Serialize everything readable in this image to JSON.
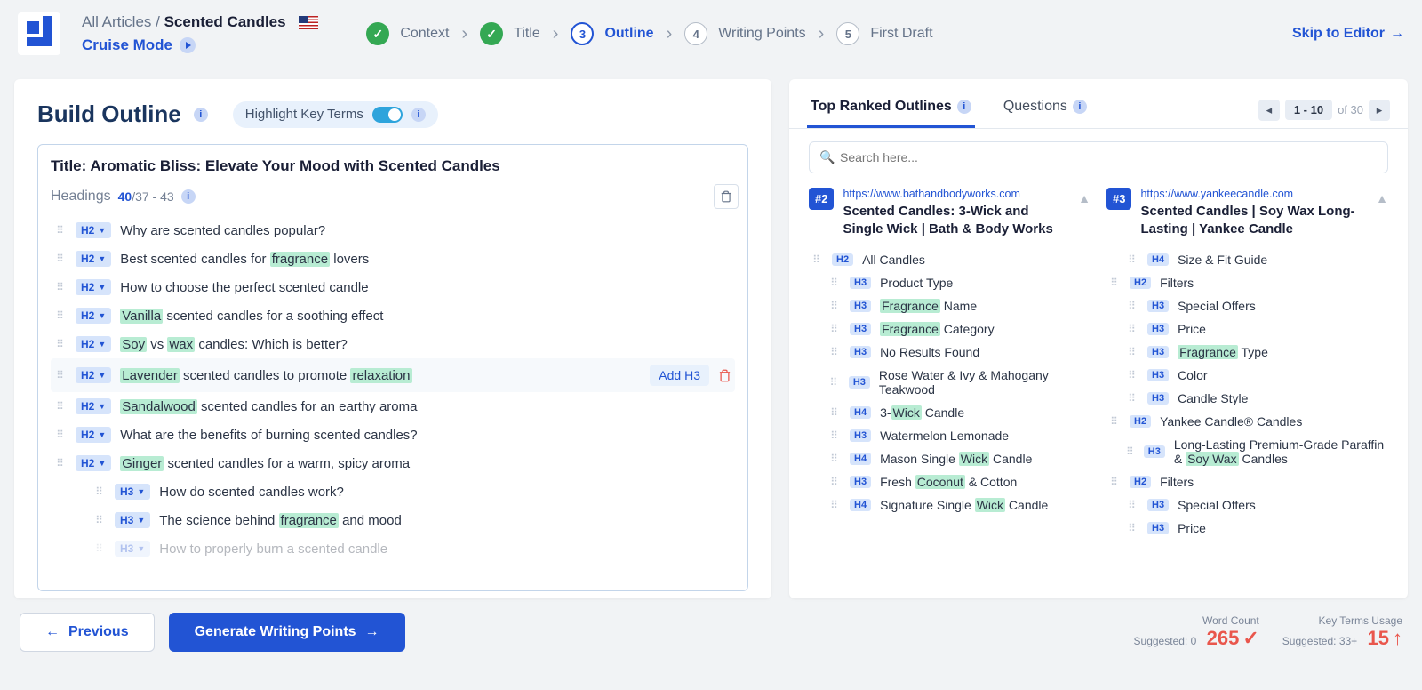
{
  "header": {
    "breadcrumb_root": "All Articles",
    "breadcrumb_current": "Scented Candles",
    "cruise_label": "Cruise Mode",
    "skip_label": "Skip to Editor"
  },
  "steps": [
    {
      "num": "✓",
      "label": "Context",
      "state": "done"
    },
    {
      "num": "✓",
      "label": "Title",
      "state": "done"
    },
    {
      "num": "3",
      "label": "Outline",
      "state": "active"
    },
    {
      "num": "4",
      "label": "Writing Points",
      "state": "pending"
    },
    {
      "num": "5",
      "label": "First Draft",
      "state": "pending"
    }
  ],
  "build": {
    "title": "Build Outline",
    "highlight_label": "Highlight Key Terms",
    "article_title_prefix": "Title: ",
    "article_title": "Aromatic Bliss: Elevate Your Mood with Scented Candles",
    "headings_label": "Headings",
    "headings_count": "40",
    "headings_range": "/37 - 43",
    "add_h3_label": "Add H3"
  },
  "outline": [
    {
      "tag": "H2",
      "parts": [
        "Why are scented candles popular?"
      ]
    },
    {
      "tag": "H2",
      "parts": [
        "Best scented candles for ",
        {
          "k": "fragrance"
        },
        " lovers"
      ]
    },
    {
      "tag": "H2",
      "parts": [
        "How to choose the perfect scented candle"
      ]
    },
    {
      "tag": "H2",
      "parts": [
        {
          "k": "Vanilla"
        },
        " scented candles for a soothing effect"
      ]
    },
    {
      "tag": "H2",
      "parts": [
        {
          "k": "Soy"
        },
        " vs ",
        {
          "k": "wax"
        },
        " candles: Which is better?"
      ]
    },
    {
      "tag": "H2",
      "parts": [
        {
          "k": "Lavender"
        },
        " scented candles to promote ",
        {
          "k": "relaxation"
        }
      ],
      "hovered": true
    },
    {
      "tag": "H2",
      "parts": [
        {
          "k": "Sandalwood"
        },
        " scented candles for an earthy aroma"
      ]
    },
    {
      "tag": "H2",
      "parts": [
        "What are the benefits of burning scented candles?"
      ]
    },
    {
      "tag": "H2",
      "parts": [
        {
          "k": "Ginger"
        },
        " scented candles for a warm, spicy aroma"
      ]
    },
    {
      "tag": "H3",
      "parts": [
        "How do scented candles work?"
      ],
      "indent": 1
    },
    {
      "tag": "H3",
      "parts": [
        "The science behind ",
        {
          "k": "fragrance"
        },
        " and mood"
      ],
      "indent": 1
    },
    {
      "tag": "H3",
      "parts": [
        "How to properly burn a scented candle"
      ],
      "indent": 1,
      "fade": true
    }
  ],
  "right": {
    "tab1": "Top Ranked Outlines",
    "tab2": "Questions",
    "range": "1 - 10",
    "total": "of 30",
    "search_placeholder": "Search here..."
  },
  "cards": [
    {
      "rank": "#2",
      "url": "https://www.bathandbodyworks.com",
      "title": "Scented Candles: 3-Wick and Single Wick | Bath & Body Works",
      "items": [
        {
          "tag": "H2",
          "parts": [
            "All Candles"
          ]
        },
        {
          "tag": "H3",
          "parts": [
            "Product Type"
          ],
          "indent": 1
        },
        {
          "tag": "H3",
          "parts": [
            {
              "k": "Fragrance"
            },
            " Name"
          ],
          "indent": 1
        },
        {
          "tag": "H3",
          "parts": [
            {
              "k": "Fragrance"
            },
            " Category"
          ],
          "indent": 1
        },
        {
          "tag": "H3",
          "parts": [
            "No Results Found"
          ],
          "indent": 1
        },
        {
          "tag": "H3",
          "parts": [
            "Rose Water & Ivy & Mahogany Teakwood"
          ],
          "indent": 1
        },
        {
          "tag": "H4",
          "parts": [
            "3-",
            {
              "k": "Wick"
            },
            " Candle"
          ],
          "indent": 1
        },
        {
          "tag": "H3",
          "parts": [
            "Watermelon Lemonade"
          ],
          "indent": 1
        },
        {
          "tag": "H4",
          "parts": [
            "Mason Single ",
            {
              "k": "Wick"
            },
            " Candle"
          ],
          "indent": 1
        },
        {
          "tag": "H3",
          "parts": [
            "Fresh ",
            {
              "k": "Coconut"
            },
            " & Cotton"
          ],
          "indent": 1
        },
        {
          "tag": "H4",
          "parts": [
            "Signature Single ",
            {
              "k": "Wick"
            },
            " Candle"
          ],
          "indent": 1
        }
      ]
    },
    {
      "rank": "#3",
      "url": "https://www.yankeecandle.com",
      "title": "Scented Candles | Soy Wax Long-Lasting | Yankee Candle",
      "items": [
        {
          "tag": "H4",
          "parts": [
            "Size & Fit Guide"
          ],
          "indent": 1
        },
        {
          "tag": "H2",
          "parts": [
            "Filters"
          ]
        },
        {
          "tag": "H3",
          "parts": [
            "Special Offers"
          ],
          "indent": 1
        },
        {
          "tag": "H3",
          "parts": [
            "Price"
          ],
          "indent": 1
        },
        {
          "tag": "H3",
          "parts": [
            {
              "k": "Fragrance"
            },
            " Type"
          ],
          "indent": 1
        },
        {
          "tag": "H3",
          "parts": [
            "Color"
          ],
          "indent": 1
        },
        {
          "tag": "H3",
          "parts": [
            "Candle Style"
          ],
          "indent": 1
        },
        {
          "tag": "H2",
          "parts": [
            "Yankee Candle® Candles"
          ]
        },
        {
          "tag": "H3",
          "parts": [
            "Long-Lasting Premium-Grade Paraffin & ",
            {
              "k": "Soy Wax"
            },
            " Candles"
          ],
          "indent": 1
        },
        {
          "tag": "H2",
          "parts": [
            "Filters"
          ]
        },
        {
          "tag": "H3",
          "parts": [
            "Special Offers"
          ],
          "indent": 1
        },
        {
          "tag": "H3",
          "parts": [
            "Price"
          ],
          "indent": 1
        }
      ]
    }
  ],
  "footer": {
    "prev": "Previous",
    "next": "Generate Writing Points",
    "wc_label": "Word Count",
    "wc_sug": "Suggested: 0",
    "wc_val": "265",
    "kt_label": "Key Terms Usage",
    "kt_sug": "Suggested: 33+",
    "kt_val": "15"
  }
}
